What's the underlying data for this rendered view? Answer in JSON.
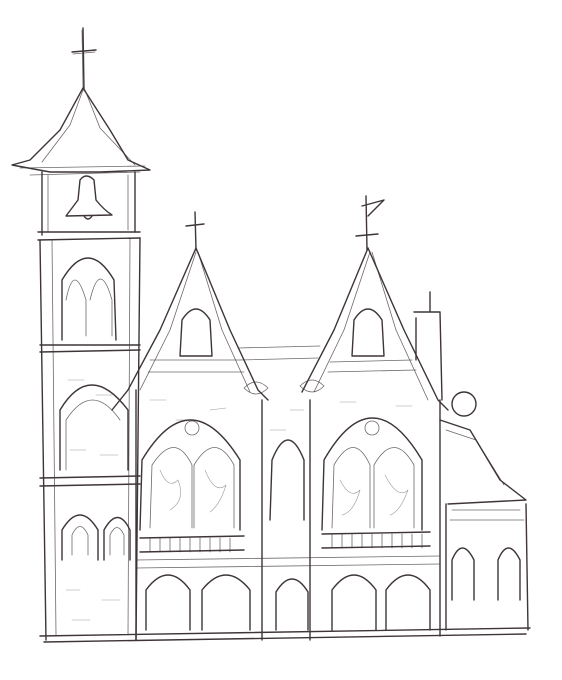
{
  "scene": {
    "subject": "church-sketch",
    "style": "pencil-sketch",
    "background_color": "#ffffff",
    "ink_color": "#3e3538"
  }
}
